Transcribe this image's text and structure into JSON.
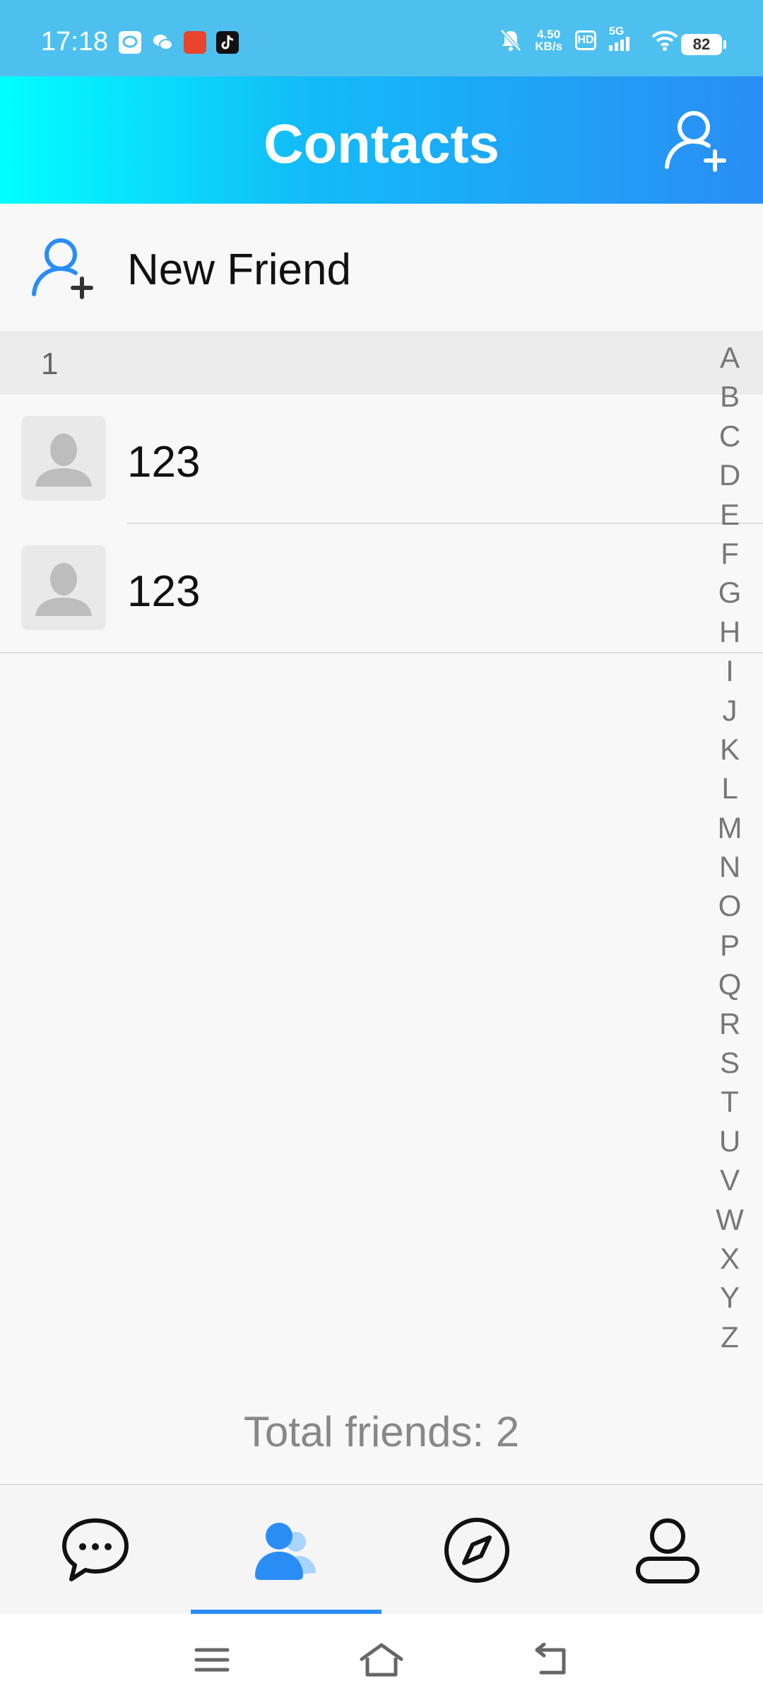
{
  "status_bar": {
    "time": "17:18",
    "net_speed_value": "4.50",
    "net_speed_unit": "KB/s",
    "hd_label": "HD",
    "network_label": "5G",
    "battery": "82"
  },
  "header": {
    "title": "Contacts"
  },
  "new_friend": {
    "label": "New Friend"
  },
  "section": {
    "letter": "1"
  },
  "contacts": [
    {
      "name": "123"
    },
    {
      "name": "123"
    }
  ],
  "alphabet": [
    "A",
    "B",
    "C",
    "D",
    "E",
    "F",
    "G",
    "H",
    "I",
    "J",
    "K",
    "L",
    "M",
    "N",
    "O",
    "P",
    "Q",
    "R",
    "S",
    "T",
    "U",
    "V",
    "W",
    "X",
    "Y",
    "Z"
  ],
  "footer": {
    "total_friends": "Total friends: 2"
  },
  "bottom_nav": {
    "active_tab": "contacts",
    "items": [
      "chat-icon",
      "contacts-icon",
      "compass-icon",
      "profile-icon"
    ]
  },
  "colors": {
    "accent": "#2a8df5",
    "header_gradient_start": "#00ffff",
    "header_gradient_end": "#2a8df5",
    "status_bar": "#4ec0f0"
  }
}
